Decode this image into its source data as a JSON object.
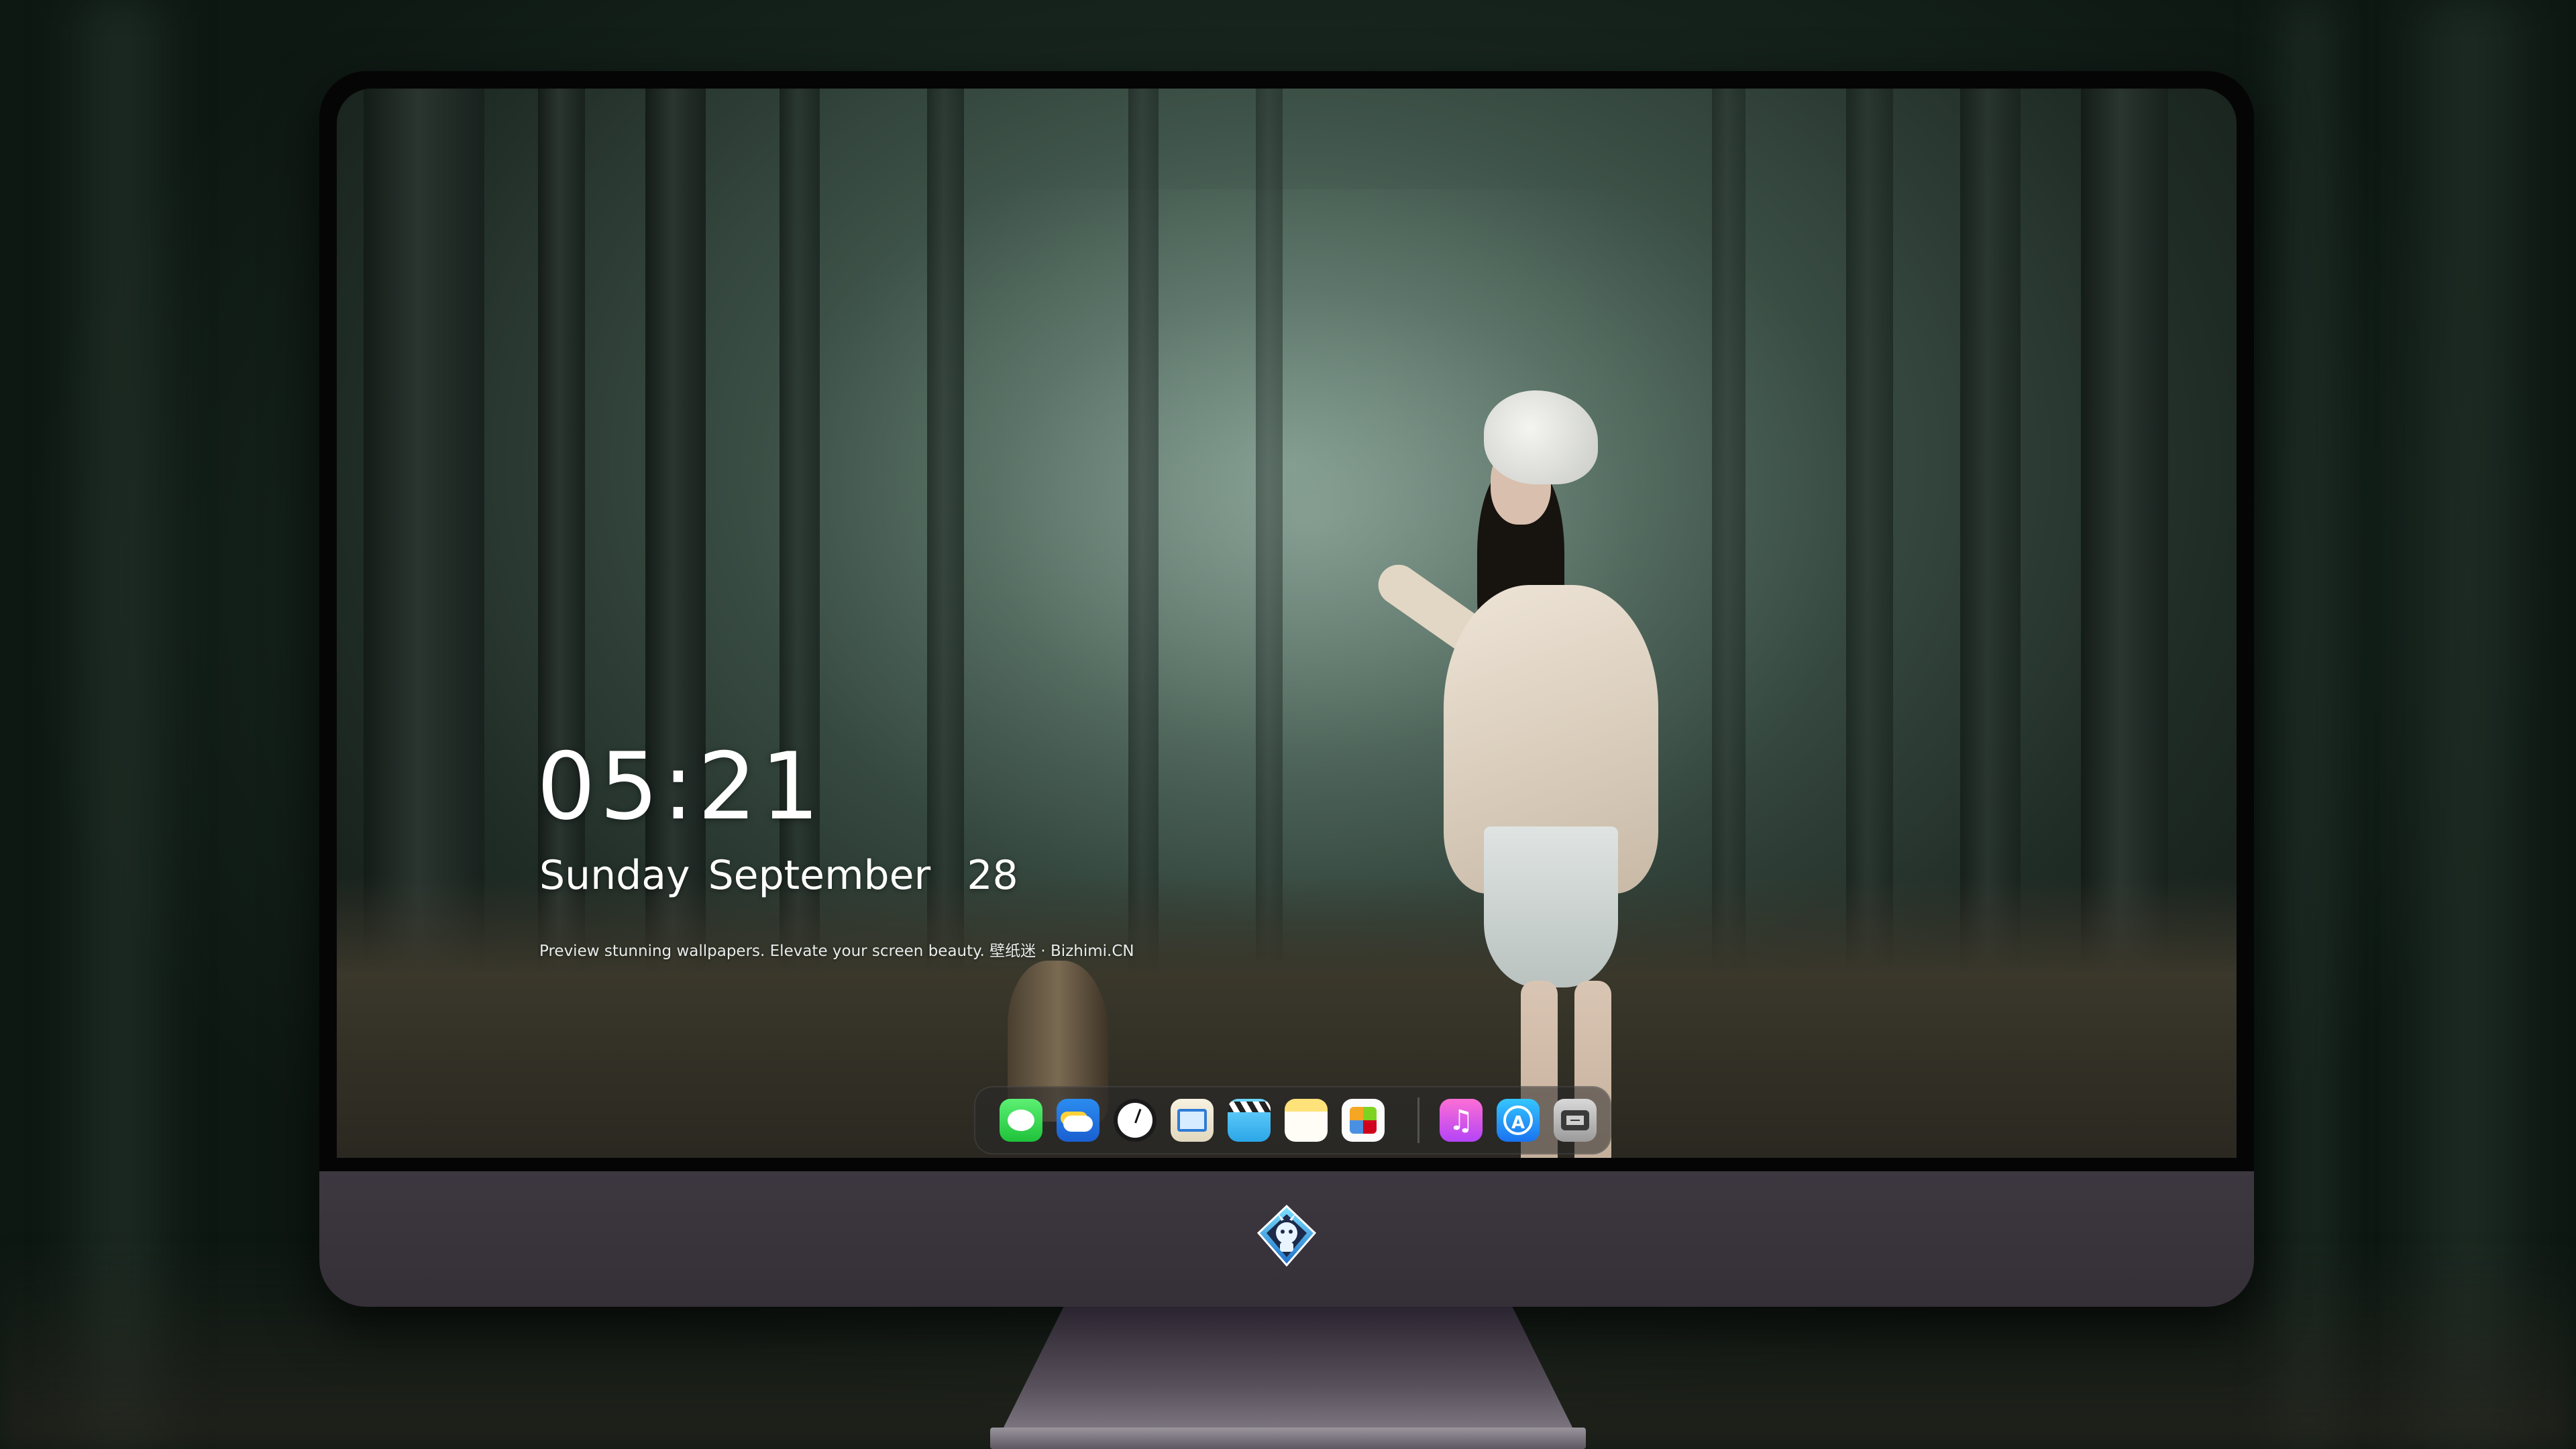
{
  "lock_screen": {
    "time": "05:21",
    "date": "Sunday September  28",
    "tagline": "Preview stunning wallpapers. Elevate your screen beauty. 壁纸迷 · Bizhimi.CN"
  },
  "dock": {
    "apps": [
      {
        "name": "messages-icon"
      },
      {
        "name": "weather-icon"
      },
      {
        "name": "clock-icon"
      },
      {
        "name": "preview-icon"
      },
      {
        "name": "clips-icon"
      },
      {
        "name": "notes-icon"
      },
      {
        "name": "photos-icon"
      }
    ],
    "apps_right": [
      {
        "name": "music-icon"
      },
      {
        "name": "app-store-icon"
      },
      {
        "name": "camera-icon"
      }
    ]
  },
  "colors": {
    "background": "#0e1813",
    "monitor_chin": "#3d3740",
    "text": "#ffffff"
  }
}
